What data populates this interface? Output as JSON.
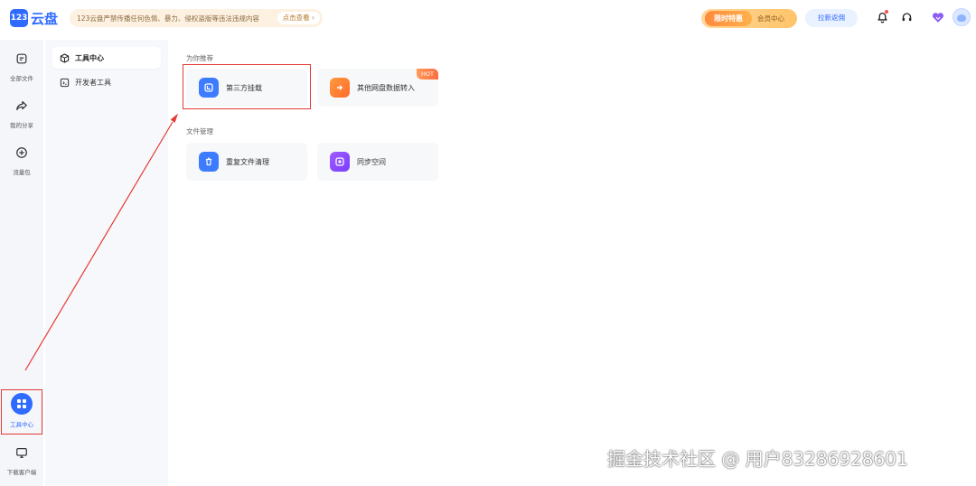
{
  "header": {
    "logo_badge": "123",
    "logo_text": "云盘",
    "notice_text": "123云盘严禁传播任何色情、暴力、侵权盗版等违法违规内容",
    "notice_link": "点击查看 ›",
    "promo_tag": "限时特惠",
    "promo_label": "会员中心",
    "invite_label": "拉新返佣"
  },
  "rail": {
    "items": [
      {
        "label": "全部文件"
      },
      {
        "label": "我的分享"
      },
      {
        "label": "流量包"
      },
      {
        "label": "工具中心"
      },
      {
        "label": "下载客户端"
      }
    ]
  },
  "subnav": {
    "items": [
      {
        "label": "工具中心"
      },
      {
        "label": "开发者工具"
      }
    ]
  },
  "main": {
    "recommend_title": "为你推荐",
    "file_title": "文件管理",
    "cards": [
      {
        "label": "第三方挂载"
      },
      {
        "label": "其他网盘数据转入",
        "badge": "HOT"
      },
      {
        "label": "重复文件清理"
      },
      {
        "label": "同步空间"
      }
    ]
  },
  "watermark": "掘金技术社区 @ 用户83286928601",
  "colors": {
    "accent": "#2f6bff",
    "highlight": "#e53935",
    "hot_badge": "#ff6b3d"
  }
}
